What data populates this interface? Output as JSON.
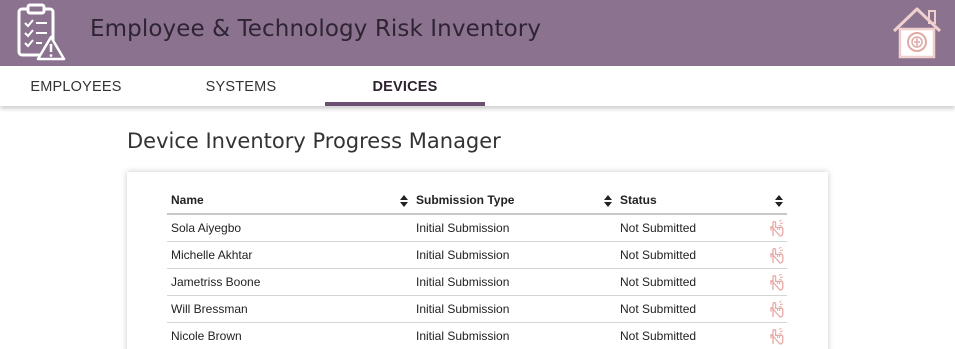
{
  "app": {
    "title": "Employee & Technology Risk Inventory",
    "logo_icon": "clipboard-warning-icon",
    "home_icon": "home-icon"
  },
  "tabs": [
    {
      "label": "EMPLOYEES",
      "active": false
    },
    {
      "label": "SYSTEMS",
      "active": false
    },
    {
      "label": "DEVICES",
      "active": true
    }
  ],
  "page": {
    "title": "Device Inventory Progress Manager"
  },
  "table": {
    "columns": [
      "Name",
      "Submission Type",
      "Status",
      ""
    ],
    "rows": [
      {
        "name": "Sola Aiyegbo",
        "type": "Initial Submission",
        "status": "Not Submitted"
      },
      {
        "name": "Michelle Akhtar",
        "type": "Initial Submission",
        "status": "Not Submitted"
      },
      {
        "name": "Jametriss Boone",
        "type": "Initial Submission",
        "status": "Not Submitted"
      },
      {
        "name": "Will Bressman",
        "type": "Initial Submission",
        "status": "Not Submitted"
      },
      {
        "name": "Nicole Brown",
        "type": "Initial Submission",
        "status": "Not Submitted"
      }
    ],
    "action_icon": "hand-pointer-icon"
  },
  "colors": {
    "header_bg": "#8b7390",
    "accent": "#6e4f74",
    "icon_pink": "#e8b4b0"
  }
}
